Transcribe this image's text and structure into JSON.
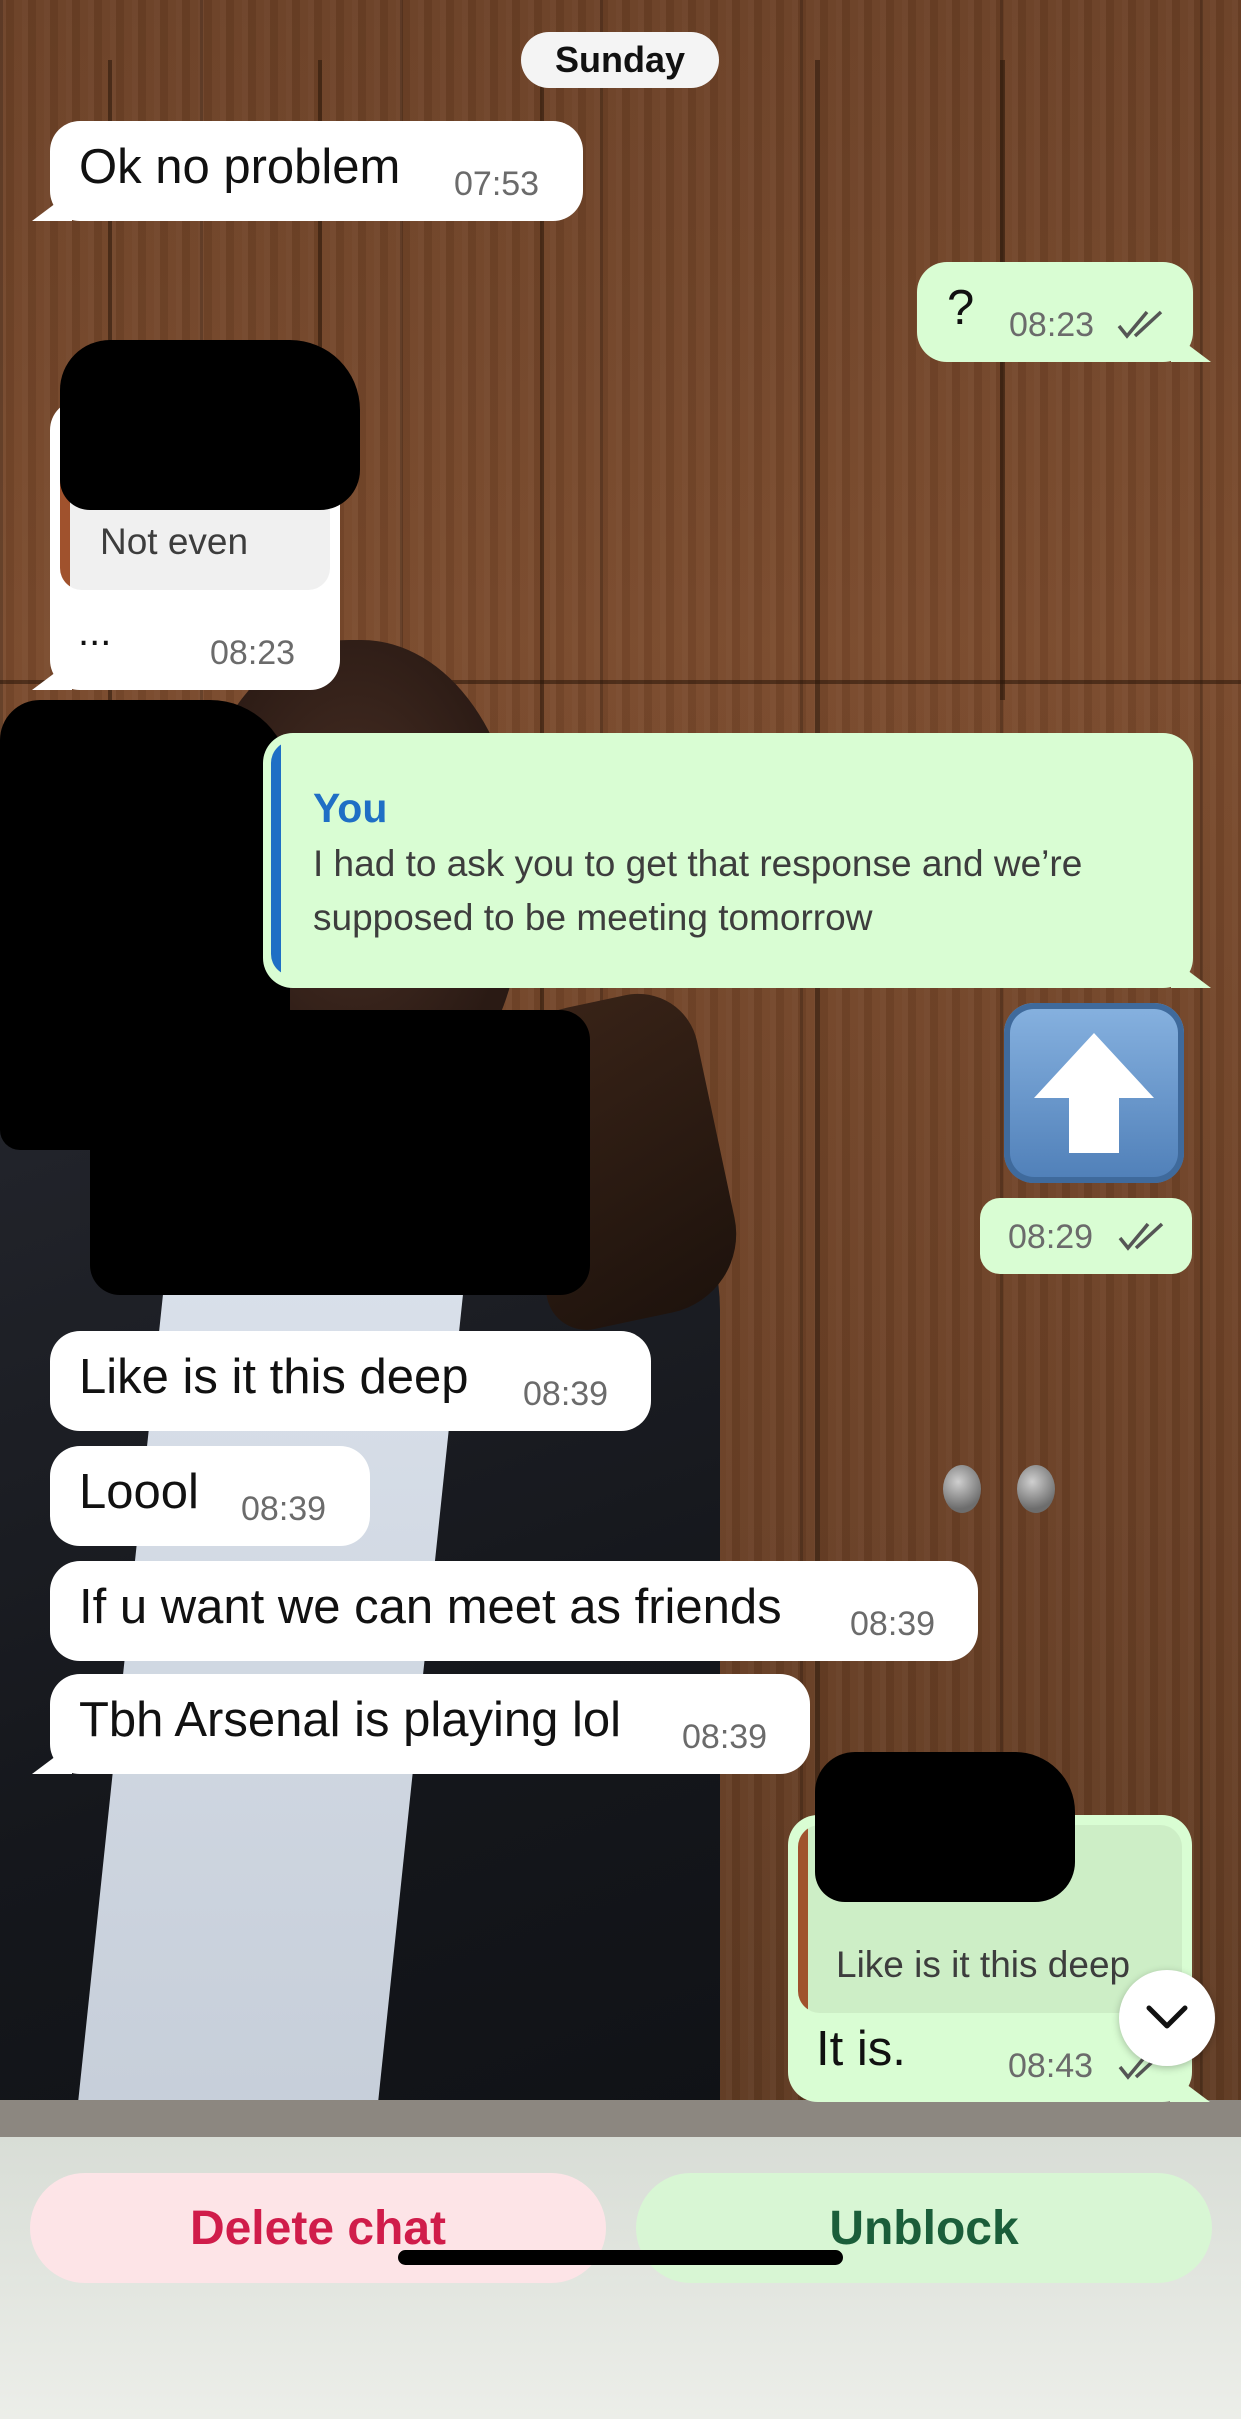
{
  "date_separator": "Sunday",
  "messages": [
    {
      "dir": "in",
      "text": "Ok no problem",
      "time": "07:53"
    },
    {
      "dir": "out",
      "text": "?",
      "time": "08:23"
    },
    {
      "dir": "in",
      "quote_text": "Not even",
      "text": "...",
      "time": "08:23"
    },
    {
      "dir": "out",
      "quote_author": "You",
      "quote_text": "I had to ask you to get that response and we’re supposed to be meeting tomorrow"
    },
    {
      "dir": "out",
      "sticker": "up-arrow-emoji",
      "time": "08:29"
    },
    {
      "dir": "in",
      "text": "Like is it this deep",
      "time": "08:39"
    },
    {
      "dir": "in",
      "text": "Loool",
      "time": "08:39"
    },
    {
      "dir": "in",
      "text": "If u want we can meet as friends",
      "time": "08:39"
    },
    {
      "dir": "in",
      "text": "Tbh Arsenal is playing lol",
      "time": "08:39"
    },
    {
      "dir": "out",
      "quote_text": "Like is it this deep",
      "text": "It is.",
      "time": "08:43"
    }
  ],
  "footer": {
    "delete_label": "Delete chat",
    "unblock_label": "Unblock"
  },
  "colors": {
    "incoming_bubble": "#ffffff",
    "outgoing_bubble": "#d9fdd3",
    "delete_text": "#d01c4a",
    "unblock_text": "#1b5e3a",
    "quote_accent_blue": "#1f6fc5",
    "quote_accent_brown": "#a0522d"
  },
  "icons": [
    "double-check-icon",
    "up-arrow-emoji",
    "chevron-down-icon"
  ]
}
